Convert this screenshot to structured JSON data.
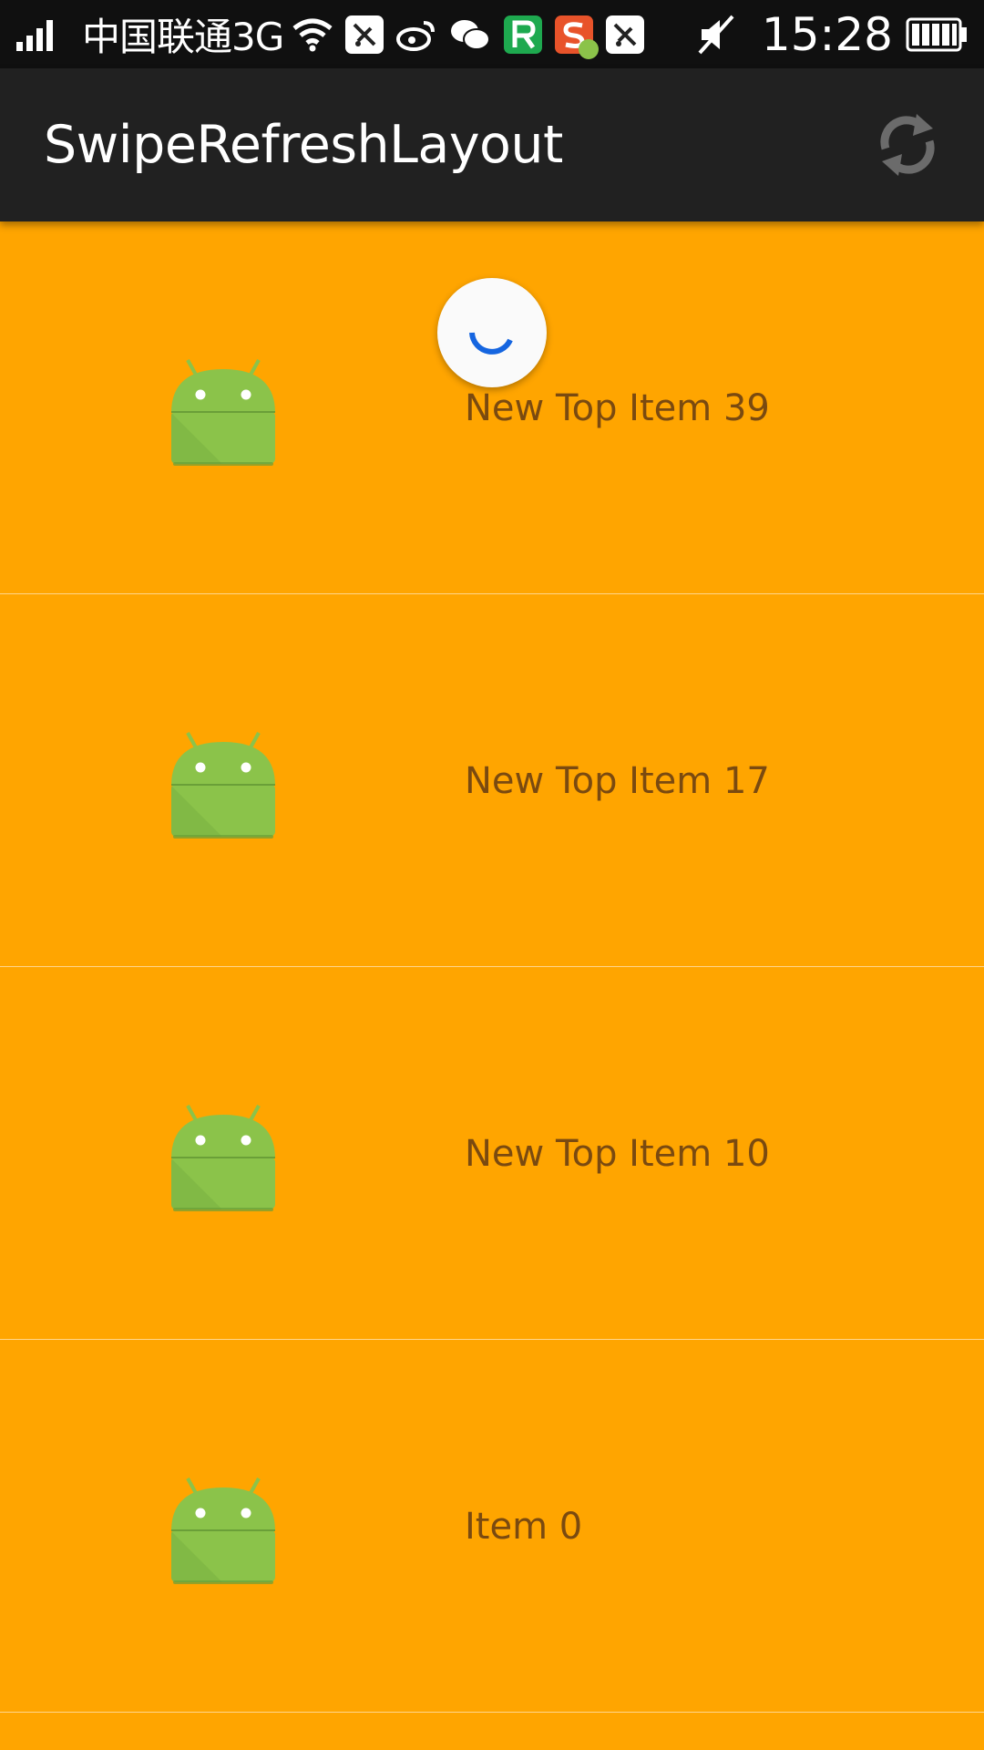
{
  "status_bar": {
    "carrier": "中国联通3G",
    "time": "15:28",
    "icons": [
      "signal-icon",
      "wifi-icon",
      "notification-app-icon",
      "weibo-icon",
      "wechat-icon",
      "r-app-icon",
      "sogou-icon",
      "notification-app-icon",
      "mute-icon",
      "battery-icon"
    ]
  },
  "app_bar": {
    "title": "SwipeRefreshLayout",
    "action_icon": "refresh-icon"
  },
  "list": {
    "items": [
      {
        "label": "New Top Item 39",
        "icon": "android-icon"
      },
      {
        "label": "New Top Item 17",
        "icon": "android-icon"
      },
      {
        "label": "New Top Item 10",
        "icon": "android-icon"
      },
      {
        "label": "Item 0",
        "icon": "android-icon"
      }
    ]
  },
  "colors": {
    "background": "#FFA500",
    "app_bar": "#212121",
    "status_bar": "#101010",
    "item_text": "#7a4a10",
    "android_green": "#8BC34A",
    "spinner_arc": "#1565E0"
  }
}
